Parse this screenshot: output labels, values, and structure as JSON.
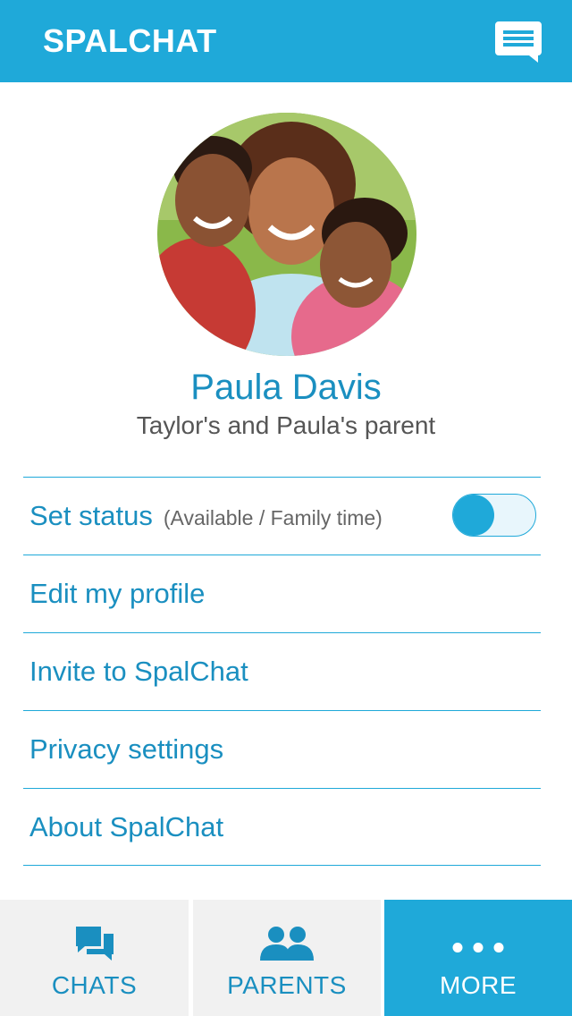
{
  "header": {
    "title": "SPALCHAT",
    "compose_icon": "chat-bubble-icon",
    "background": "#1fa9d9"
  },
  "profile": {
    "avatar": "family-photo",
    "name": "Paula Davis",
    "role": "Taylor's and Paula's parent"
  },
  "menu": {
    "items": [
      {
        "label": "Set status",
        "sub": "(Available / Family time)",
        "toggle_on": true
      },
      {
        "label": "Edit my profile"
      },
      {
        "label": "Invite to SpalChat"
      },
      {
        "label": "Privacy settings"
      },
      {
        "label": "About SpalChat"
      }
    ]
  },
  "bottom_nav": {
    "tabs": [
      {
        "label": "CHATS",
        "icon": "chats-icon",
        "active": false
      },
      {
        "label": "PARENTS",
        "icon": "parents-icon",
        "active": false
      },
      {
        "label": "MORE",
        "icon": "more-dots-icon",
        "active": true
      }
    ]
  },
  "colors": {
    "accent": "#1fa9d9",
    "text_accent": "#1a8fc0",
    "nav_inactive_bg": "#f1f1f1"
  }
}
